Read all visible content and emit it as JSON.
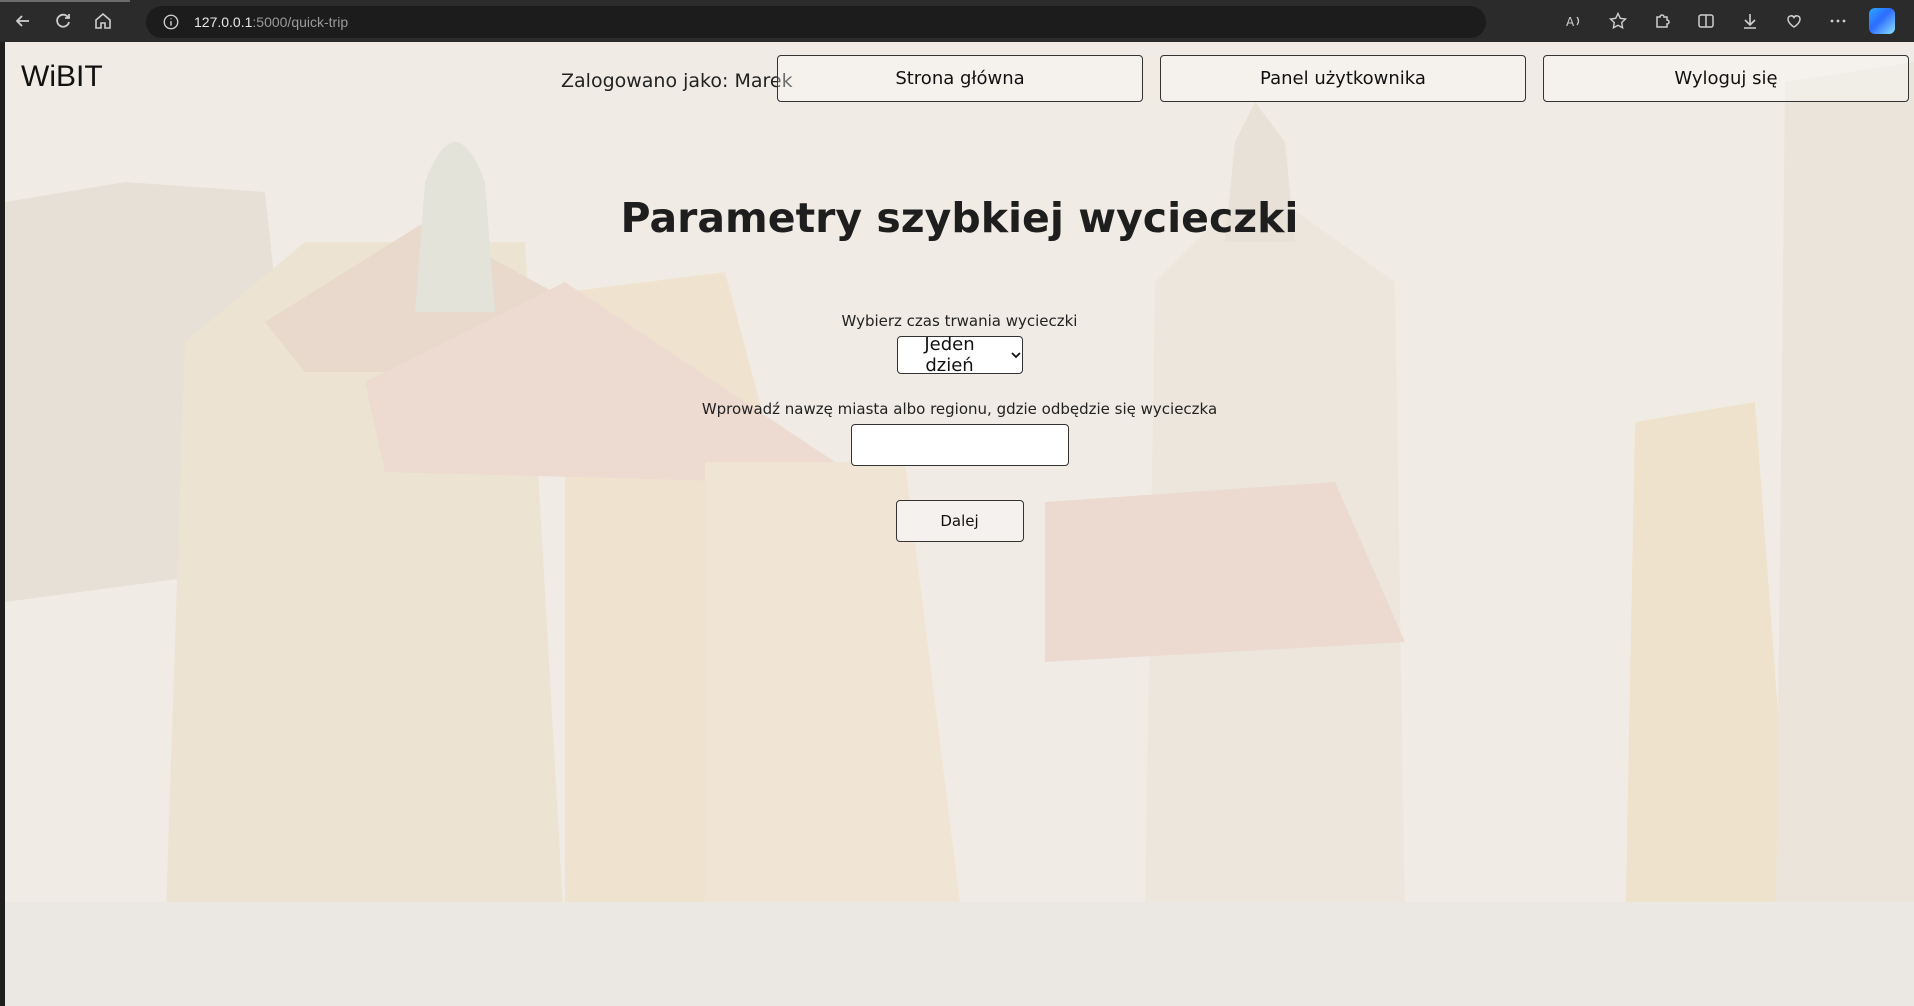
{
  "browser": {
    "url_host": "127.0.0.1",
    "url_path": ":5000/quick-trip"
  },
  "app": {
    "logo": "WiBIT",
    "user_label": "Zalogowano jako: Marek",
    "nav": {
      "home": "Strona główna",
      "panel": "Panel użytkownika",
      "logout": "Wyloguj się"
    }
  },
  "page": {
    "title": "Parametry szybkiej wycieczki",
    "duration_label": "Wybierz czas trwania wycieczki",
    "duration_value": "Jeden dzień",
    "location_label": "Wprowadź nawzę miasta albo regionu, gdzie odbędzie się wycieczka",
    "location_value": "",
    "submit_label": "Dalej"
  },
  "colors": {
    "background_tint": "#f1ede6",
    "chrome": "#2b2b2b"
  }
}
